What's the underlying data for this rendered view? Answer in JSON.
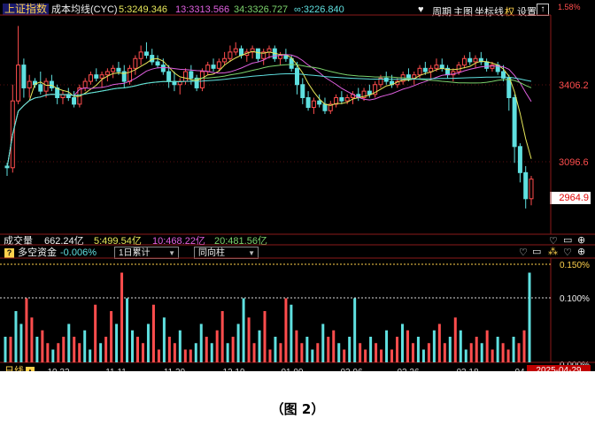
{
  "main_header": {
    "index_name": "上证指数",
    "indicator_name": "成本均线(CYC)",
    "ma5": "5:3249.346",
    "ma13": "13:3313.566",
    "ma34": "34:3326.727",
    "ma_inf": "∞:3226.840"
  },
  "toolbar": {
    "period_label": "周期",
    "main_label": "主图",
    "crosshair_label": "坐标线",
    "rights_label": "权",
    "settings_label": "设置",
    "up_icon": "up-arrow-icon"
  },
  "price_axis": {
    "top_label": "1.58%",
    "tick_high": "3406.2",
    "tick_low": "3096.6",
    "last_price": "2964.9"
  },
  "volume_header": {
    "label": "成交量",
    "total": "662.24亿",
    "ma5": "5:499.54亿",
    "ma10": "10:468.22亿",
    "ma20": "20:481.56亿"
  },
  "flow_panel": {
    "title": "多空资金",
    "value": "-0.006%",
    "select_period": "1日累计",
    "select_mode": "同向柱",
    "y_top": "0.150%",
    "y_mid": "0.100%",
    "y_bottom": "0.000%"
  },
  "bottom_bar": {
    "period": "日线",
    "current_date": "2025-04-29",
    "x_labels": [
      "10.22",
      "11.11",
      "11.29",
      "12.19",
      "01.09",
      "02.06",
      "02.26",
      "03.18",
      "04"
    ]
  },
  "figure_caption": "（图 2）",
  "colors": {
    "background": "#000000",
    "up": "#ff4d4d",
    "down": "#5fe0e0",
    "ma5": "#e8e85a",
    "ma13": "#e060e0",
    "ma34": "#7cd36c",
    "ma_inf": "#5fe0e0",
    "grid": "#8b1a1a"
  },
  "chart_data": {
    "type": "candlestick",
    "ylim": [
      2900,
      3540
    ],
    "candles": [
      [
        3090,
        3100,
        3060,
        3085
      ],
      [
        3085,
        3340,
        3070,
        3290
      ],
      [
        3290,
        3520,
        3280,
        3400
      ],
      [
        3400,
        3420,
        3300,
        3330
      ],
      [
        3330,
        3370,
        3300,
        3350
      ],
      [
        3350,
        3360,
        3330,
        3340
      ],
      [
        3340,
        3380,
        3310,
        3320
      ],
      [
        3320,
        3360,
        3300,
        3350
      ],
      [
        3350,
        3370,
        3320,
        3330
      ],
      [
        3330,
        3340,
        3280,
        3300
      ],
      [
        3300,
        3320,
        3280,
        3310
      ],
      [
        3310,
        3330,
        3290,
        3300
      ],
      [
        3300,
        3320,
        3270,
        3280
      ],
      [
        3280,
        3340,
        3270,
        3330
      ],
      [
        3330,
        3360,
        3320,
        3350
      ],
      [
        3350,
        3380,
        3340,
        3370
      ],
      [
        3370,
        3390,
        3350,
        3360
      ],
      [
        3360,
        3380,
        3330,
        3370
      ],
      [
        3370,
        3390,
        3350,
        3380
      ],
      [
        3380,
        3400,
        3360,
        3390
      ],
      [
        3390,
        3410,
        3370,
        3380
      ],
      [
        3380,
        3400,
        3330,
        3350
      ],
      [
        3350,
        3400,
        3340,
        3390
      ],
      [
        3390,
        3430,
        3370,
        3420
      ],
      [
        3420,
        3460,
        3400,
        3440
      ],
      [
        3440,
        3470,
        3420,
        3430
      ],
      [
        3430,
        3450,
        3400,
        3410
      ],
      [
        3410,
        3430,
        3390,
        3400
      ],
      [
        3400,
        3420,
        3370,
        3380
      ],
      [
        3380,
        3400,
        3330,
        3350
      ],
      [
        3350,
        3380,
        3320,
        3340
      ],
      [
        3340,
        3360,
        3310,
        3350
      ],
      [
        3350,
        3390,
        3340,
        3380
      ],
      [
        3380,
        3400,
        3340,
        3360
      ],
      [
        3360,
        3370,
        3320,
        3330
      ],
      [
        3330,
        3390,
        3320,
        3380
      ],
      [
        3380,
        3410,
        3370,
        3400
      ],
      [
        3400,
        3420,
        3380,
        3390
      ],
      [
        3390,
        3420,
        3380,
        3410
      ],
      [
        3410,
        3440,
        3400,
        3420
      ],
      [
        3420,
        3460,
        3410,
        3440
      ],
      [
        3440,
        3470,
        3430,
        3450
      ],
      [
        3450,
        3460,
        3420,
        3430
      ],
      [
        3430,
        3450,
        3410,
        3440
      ],
      [
        3440,
        3460,
        3420,
        3450
      ],
      [
        3450,
        3440,
        3410,
        3420
      ],
      [
        3420,
        3450,
        3400,
        3440
      ],
      [
        3440,
        3460,
        3420,
        3450
      ],
      [
        3450,
        3460,
        3410,
        3420
      ],
      [
        3420,
        3440,
        3400,
        3430
      ],
      [
        3430,
        3450,
        3410,
        3420
      ],
      [
        3420,
        3430,
        3380,
        3390
      ],
      [
        3390,
        3410,
        3310,
        3340
      ],
      [
        3340,
        3360,
        3280,
        3300
      ],
      [
        3300,
        3320,
        3260,
        3270
      ],
      [
        3270,
        3300,
        3250,
        3290
      ],
      [
        3290,
        3310,
        3270,
        3280
      ],
      [
        3280,
        3300,
        3250,
        3260
      ],
      [
        3260,
        3290,
        3250,
        3280
      ],
      [
        3280,
        3310,
        3270,
        3300
      ],
      [
        3300,
        3320,
        3280,
        3290
      ],
      [
        3290,
        3310,
        3280,
        3300
      ],
      [
        3300,
        3320,
        3280,
        3310
      ],
      [
        3310,
        3330,
        3290,
        3300
      ],
      [
        3300,
        3330,
        3290,
        3320
      ],
      [
        3320,
        3340,
        3300,
        3310
      ],
      [
        3310,
        3350,
        3300,
        3340
      ],
      [
        3340,
        3370,
        3330,
        3360
      ],
      [
        3360,
        3380,
        3340,
        3350
      ],
      [
        3350,
        3370,
        3330,
        3340
      ],
      [
        3340,
        3360,
        3330,
        3350
      ],
      [
        3350,
        3380,
        3340,
        3370
      ],
      [
        3370,
        3390,
        3350,
        3360
      ],
      [
        3360,
        3380,
        3340,
        3370
      ],
      [
        3370,
        3400,
        3360,
        3390
      ],
      [
        3390,
        3410,
        3370,
        3380
      ],
      [
        3380,
        3400,
        3360,
        3390
      ],
      [
        3390,
        3420,
        3380,
        3400
      ],
      [
        3400,
        3420,
        3380,
        3390
      ],
      [
        3390,
        3400,
        3360,
        3370
      ],
      [
        3370,
        3390,
        3350,
        3380
      ],
      [
        3380,
        3410,
        3370,
        3400
      ],
      [
        3400,
        3430,
        3390,
        3420
      ],
      [
        3420,
        3440,
        3400,
        3410
      ],
      [
        3410,
        3430,
        3390,
        3420
      ],
      [
        3420,
        3440,
        3400,
        3410
      ],
      [
        3410,
        3420,
        3380,
        3390
      ],
      [
        3390,
        3410,
        3380,
        3400
      ],
      [
        3400,
        3410,
        3370,
        3380
      ],
      [
        3380,
        3400,
        3350,
        3360
      ],
      [
        3360,
        3370,
        3260,
        3300
      ],
      [
        3300,
        3310,
        3100,
        3150
      ],
      [
        3150,
        3160,
        3040,
        3070
      ],
      [
        3070,
        3090,
        2960,
        2990
      ],
      [
        2990,
        3060,
        2970,
        3050
      ]
    ],
    "flow_values": [
      0.04,
      0.04,
      0.08,
      0.06,
      0.1,
      0.07,
      0.04,
      0.05,
      0.03,
      0.02,
      0.03,
      0.04,
      0.06,
      0.04,
      0.03,
      0.05,
      0.02,
      0.09,
      0.03,
      0.04,
      0.08,
      0.06,
      0.14,
      0.1,
      0.05,
      0.04,
      0.03,
      0.06,
      0.09,
      0.02,
      0.07,
      0.04,
      0.03,
      0.05,
      0.02,
      0.02,
      0.03,
      0.06,
      0.04,
      0.03,
      0.05,
      0.08,
      0.03,
      0.04,
      0.06,
      0.1,
      0.07,
      0.03,
      0.05,
      0.08,
      0.02,
      0.04,
      0.03,
      0.1,
      0.09,
      0.05,
      0.03,
      0.04,
      0.02,
      0.03,
      0.06,
      0.04,
      0.05,
      0.03,
      0.02,
      0.04,
      0.1,
      0.03,
      0.02,
      0.04,
      0.03,
      0.02,
      0.05,
      0.02,
      0.04,
      0.06,
      0.05,
      0.03,
      0.04,
      0.02,
      0.03,
      0.05,
      0.06,
      0.03,
      0.04,
      0.07,
      0.05,
      0.02,
      0.03,
      0.04,
      0.03,
      0.05,
      0.02,
      0.04,
      0.03,
      0.02,
      0.04,
      0.03,
      0.05,
      0.14
    ],
    "flow_ylim": [
      0,
      0.16
    ]
  }
}
